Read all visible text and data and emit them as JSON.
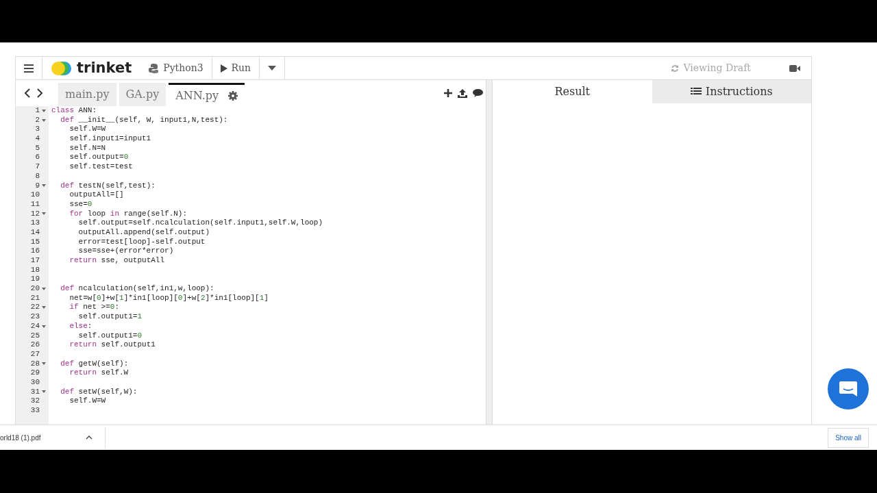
{
  "header": {
    "brand": "trinket",
    "language": "Python3",
    "run_label": "Run",
    "status": "Viewing Draft"
  },
  "file_tabs": [
    {
      "label": "main.py",
      "selected": false
    },
    {
      "label": "GA.py",
      "selected": false
    },
    {
      "label": "ANN.py",
      "selected": true
    }
  ],
  "output_tabs": [
    {
      "label": "Result",
      "selected": true
    },
    {
      "label": "Instructions",
      "selected": false
    }
  ],
  "code": [
    {
      "number": "1",
      "foldable": true,
      "tokens": [
        {
          "kind": "keyword",
          "text": "class"
        },
        {
          "kind": "plain",
          "text": " ANN:"
        }
      ]
    },
    {
      "number": "2",
      "foldable": true,
      "tokens": [
        {
          "kind": "keyword",
          "text": "  def"
        },
        {
          "kind": "plain",
          "text": " __init__(self, W, input1,N,test):"
        }
      ]
    },
    {
      "number": "3",
      "foldable": false,
      "tokens": [
        {
          "kind": "plain",
          "text": "    self.W=W"
        }
      ]
    },
    {
      "number": "4",
      "foldable": false,
      "tokens": [
        {
          "kind": "plain",
          "text": "    self.input1=input1"
        }
      ]
    },
    {
      "number": "5",
      "foldable": false,
      "tokens": [
        {
          "kind": "plain",
          "text": "    self.N=N"
        }
      ]
    },
    {
      "number": "6",
      "foldable": false,
      "tokens": [
        {
          "kind": "plain",
          "text": "    self.output="
        },
        {
          "kind": "number",
          "text": "0"
        }
      ]
    },
    {
      "number": "7",
      "foldable": false,
      "tokens": [
        {
          "kind": "plain",
          "text": "    self.test=test"
        }
      ]
    },
    {
      "number": "8",
      "foldable": false
    },
    {
      "number": "9",
      "foldable": true,
      "tokens": [
        {
          "kind": "keyword",
          "text": "  def"
        },
        {
          "kind": "plain",
          "text": " testN(self,test):"
        }
      ]
    },
    {
      "number": "10",
      "foldable": false,
      "tokens": [
        {
          "kind": "plain",
          "text": "    outputAll=[]"
        }
      ]
    },
    {
      "number": "11",
      "foldable": false,
      "tokens": [
        {
          "kind": "plain",
          "text": "    sse="
        },
        {
          "kind": "number",
          "text": "0"
        }
      ]
    },
    {
      "number": "12",
      "foldable": true,
      "tokens": [
        {
          "kind": "keyword",
          "text": "    for"
        },
        {
          "kind": "plain",
          "text": " loop "
        },
        {
          "kind": "keyword",
          "text": "in"
        },
        {
          "kind": "plain",
          "text": " range(self.N):"
        }
      ]
    },
    {
      "number": "13",
      "foldable": false,
      "tokens": [
        {
          "kind": "plain",
          "text": "      self.output=self.ncalculation(self.input1,self.W,loop)"
        }
      ]
    },
    {
      "number": "14",
      "foldable": false,
      "tokens": [
        {
          "kind": "plain",
          "text": "      outputAll.append(self.output)"
        }
      ]
    },
    {
      "number": "15",
      "foldable": false,
      "tokens": [
        {
          "kind": "plain",
          "text": "      error=test[loop]-self.output"
        }
      ]
    },
    {
      "number": "16",
      "foldable": false,
      "tokens": [
        {
          "kind": "plain",
          "text": "      sse=sse+(error*error)"
        }
      ]
    },
    {
      "number": "17",
      "foldable": false,
      "tokens": [
        {
          "kind": "keyword",
          "text": "    return"
        },
        {
          "kind": "plain",
          "text": " sse, outputAll"
        }
      ]
    },
    {
      "number": "18",
      "foldable": false
    },
    {
      "number": "19",
      "foldable": false
    },
    {
      "number": "20",
      "foldable": true,
      "tokens": [
        {
          "kind": "keyword",
          "text": "  def"
        },
        {
          "kind": "plain",
          "text": " ncalculation(self,in1,w,loop):"
        }
      ]
    },
    {
      "number": "21",
      "foldable": false,
      "tokens": [
        {
          "kind": "plain",
          "text": "    net=w["
        },
        {
          "kind": "number",
          "text": "0"
        },
        {
          "kind": "plain",
          "text": "]+w["
        },
        {
          "kind": "number",
          "text": "1"
        },
        {
          "kind": "plain",
          "text": "]*in1[loop]["
        },
        {
          "kind": "number",
          "text": "0"
        },
        {
          "kind": "plain",
          "text": "]+w["
        },
        {
          "kind": "number",
          "text": "2"
        },
        {
          "kind": "plain",
          "text": "]*in1[loop]["
        },
        {
          "kind": "number",
          "text": "1"
        },
        {
          "kind": "plain",
          "text": "]"
        }
      ]
    },
    {
      "number": "22",
      "foldable": true,
      "tokens": [
        {
          "kind": "keyword",
          "text": "    if"
        },
        {
          "kind": "plain",
          "text": " net >="
        },
        {
          "kind": "number",
          "text": "0"
        },
        {
          "kind": "plain",
          "text": ":"
        }
      ]
    },
    {
      "number": "23",
      "foldable": false,
      "tokens": [
        {
          "kind": "plain",
          "text": "      self.output1="
        },
        {
          "kind": "number",
          "text": "1"
        }
      ]
    },
    {
      "number": "24",
      "foldable": true,
      "tokens": [
        {
          "kind": "keyword",
          "text": "    else"
        },
        {
          "kind": "plain",
          "text": ":"
        }
      ]
    },
    {
      "number": "25",
      "foldable": false,
      "tokens": [
        {
          "kind": "plain",
          "text": "      self.output1="
        },
        {
          "kind": "number",
          "text": "0"
        }
      ]
    },
    {
      "number": "26",
      "foldable": false,
      "tokens": [
        {
          "kind": "keyword",
          "text": "    return"
        },
        {
          "kind": "plain",
          "text": " self.output1"
        }
      ]
    },
    {
      "number": "27",
      "foldable": false
    },
    {
      "number": "28",
      "foldable": true,
      "tokens": [
        {
          "kind": "keyword",
          "text": "  def"
        },
        {
          "kind": "plain",
          "text": " getW(self):"
        }
      ]
    },
    {
      "number": "29",
      "foldable": false,
      "tokens": [
        {
          "kind": "keyword",
          "text": "    return"
        },
        {
          "kind": "plain",
          "text": " self.W"
        }
      ]
    },
    {
      "number": "30",
      "foldable": false
    },
    {
      "number": "31",
      "foldable": true,
      "tokens": [
        {
          "kind": "keyword",
          "text": "  def"
        },
        {
          "kind": "plain",
          "text": " setW(self,W):"
        }
      ]
    },
    {
      "number": "32",
      "foldable": false,
      "tokens": [
        {
          "kind": "plain",
          "text": "    self.W=W"
        }
      ]
    },
    {
      "number": "33",
      "foldable": false
    }
  ],
  "download_bar": {
    "file": "orld18 (1).pdf",
    "show_all": "Show all"
  }
}
